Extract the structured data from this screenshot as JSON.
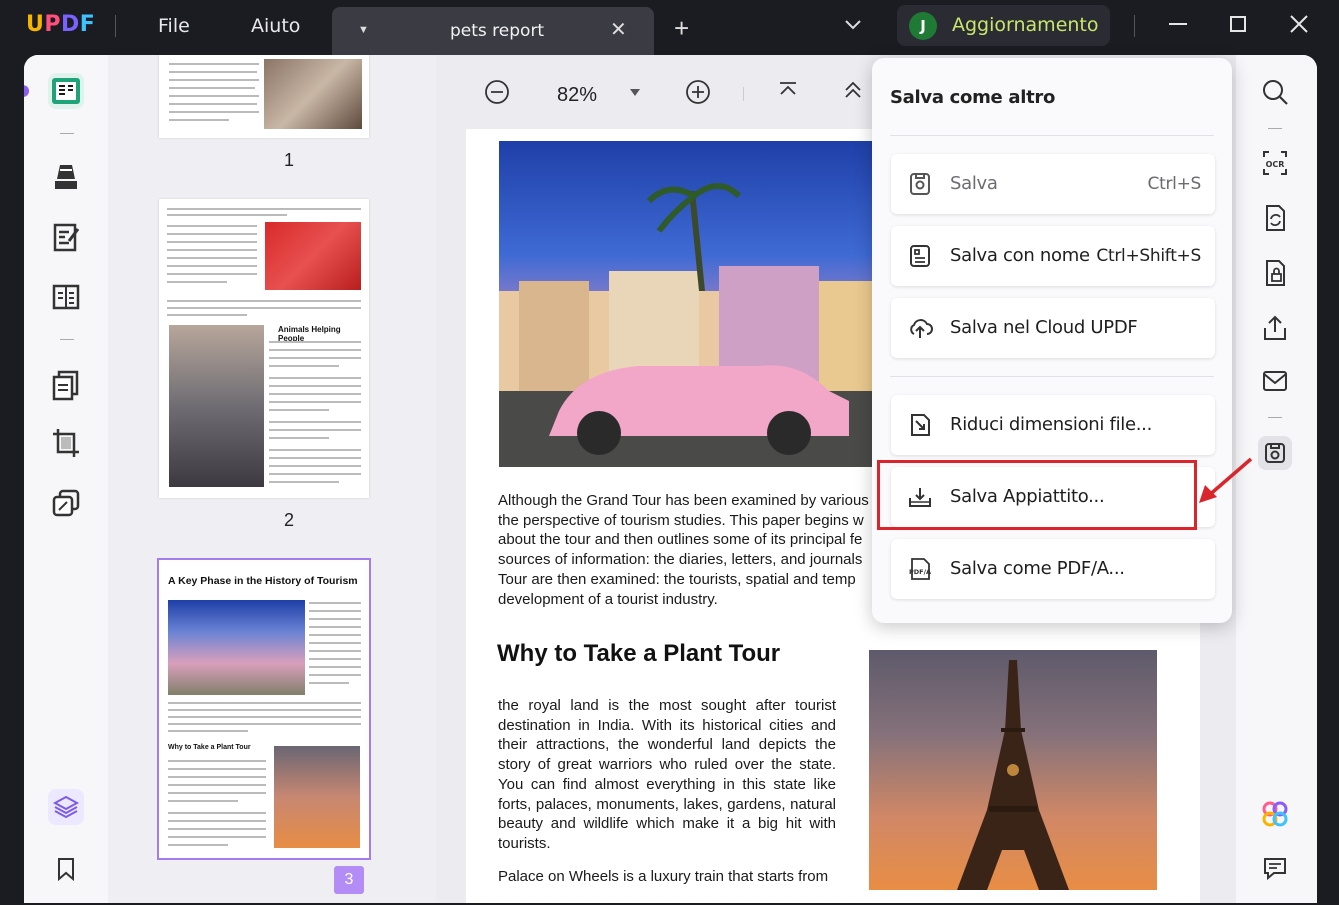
{
  "app": {
    "brand_letters": [
      "U",
      "P",
      "D",
      "F"
    ]
  },
  "menu": {
    "file": "File",
    "help": "Aiuto"
  },
  "tab": {
    "title": "pets report"
  },
  "account": {
    "initial": "J",
    "upgrade_label": "Aggiornamento"
  },
  "toolbar": {
    "zoom": "82%"
  },
  "thumbnails": {
    "pages": [
      {
        "number": "1"
      },
      {
        "number": "2",
        "heading": "Animals Helping People"
      },
      {
        "number": "3",
        "heading": "A Key Phase in the History of Tourism",
        "subheading": "Why to Take a Plant Tour"
      }
    ]
  },
  "document": {
    "intro_lines": [
      "Although the Grand Tour has been examined by various c",
      "the perspective of tourism studies. This paper begins w",
      "about the tour and then outlines some of its principal fe",
      "sources of information: the diaries, letters, and journals",
      "Tour are then examined: the tourists, spatial and temp",
      "development of a tourist industry."
    ],
    "section_heading": "Why to Take a Plant Tour",
    "body_lines": [
      "the royal land is the most sought after tourist",
      "destination in India. With its historical cities and",
      "their attractions, the wonderful land depicts the",
      "story of great warriors who ruled over the state.",
      "You can find almost everything in this state like",
      "forts, palaces, monuments, lakes, gardens, natural",
      "beauty and wildlife which make it a big hit with",
      "tourists."
    ],
    "last_line": "Palace on Wheels is a luxury train that starts from"
  },
  "save_menu": {
    "title": "Salva come altro",
    "items": [
      {
        "label": "Salva",
        "shortcut": "Ctrl+S",
        "icon": "save-icon"
      },
      {
        "label": "Salva con nome",
        "shortcut": "Ctrl+Shift+S",
        "icon": "save-as-icon"
      },
      {
        "label": "Salva nel Cloud UPDF",
        "icon": "cloud-upload-icon"
      },
      {
        "label": "Riduci dimensioni file...",
        "icon": "compress-icon"
      },
      {
        "label": "Salva Appiattito...",
        "icon": "flatten-save-icon"
      },
      {
        "label": "Salva come PDF/A...",
        "icon": "pdfa-icon"
      }
    ]
  },
  "colors": {
    "accent": "#8b5cf6",
    "highlight": "#d9252b",
    "upgrade_text": "#c7e66c"
  }
}
